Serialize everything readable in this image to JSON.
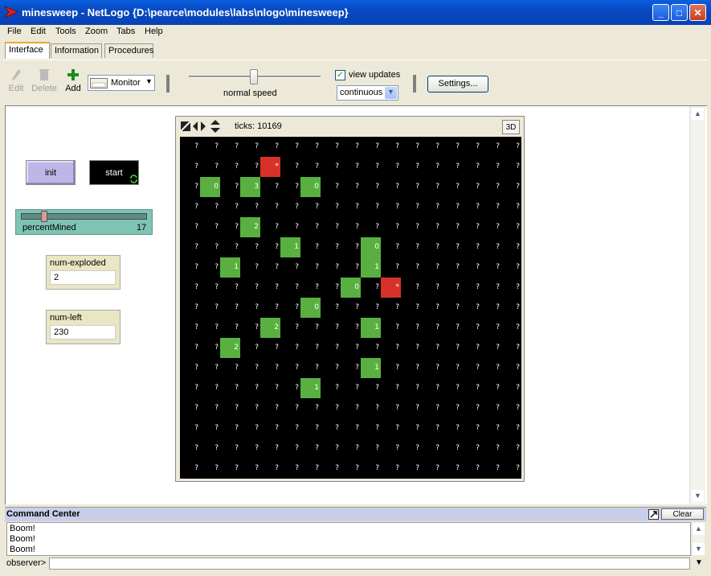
{
  "window": {
    "title": "minesweep - NetLogo {D:\\pearce\\modules\\labs\\nlogo\\minesweep}"
  },
  "menu": [
    "File",
    "Edit",
    "Tools",
    "Zoom",
    "Tabs",
    "Help"
  ],
  "tabs": [
    "Interface",
    "Information",
    "Procedures"
  ],
  "toolbar": {
    "edit_label": "Edit",
    "delete_label": "Delete",
    "add_label": "Add",
    "widget_type": "Monitor",
    "speed_label": "normal speed",
    "view_updates_label": "view updates",
    "update_mode": "continuous",
    "settings_label": "Settings..."
  },
  "widgets": {
    "init_label": "init",
    "start_label": "start",
    "slider": {
      "name": "percentMined",
      "value": "17",
      "fraction": 0.17
    },
    "num_exploded": {
      "label": "num-exploded",
      "value": "2"
    },
    "num_left": {
      "label": "num-left",
      "value": "230"
    }
  },
  "view": {
    "ticks_label": "ticks: 10169",
    "three_d_label": "3D",
    "colors": {
      "background": "#000000",
      "revealed": "#59B041",
      "exploded": "#D73229",
      "label": "#FFFFFF"
    },
    "grid": [
      "?????????????????",
      "????*????????????",
      "?0?3??0??????????",
      "?????????????????",
      "???2?????????????",
      "?????1???0???????",
      "??1??????1???????",
      "????????0?*??????",
      "??????0??????????",
      "????2????1???????",
      "??2??????????????",
      "?????????1???????",
      "??????1??????????",
      "?????????????????",
      "?????????????????",
      "?????????????????",
      "?????????????????"
    ]
  },
  "command_center": {
    "title": "Command Center",
    "clear_label": "Clear",
    "output": [
      "Boom!",
      "Boom!",
      "Boom!"
    ],
    "prompt": "observer>"
  }
}
